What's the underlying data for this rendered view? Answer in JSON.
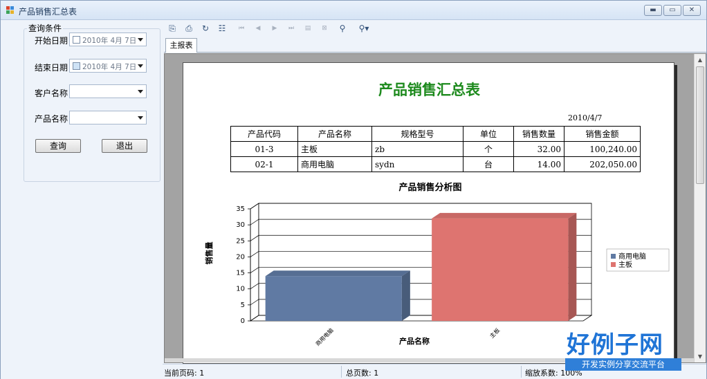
{
  "window": {
    "title": "产品销售汇总表"
  },
  "left_panel": {
    "group_title": "查询条件",
    "start_date": {
      "label": "开始日期",
      "value": "2010年 4月 7日"
    },
    "end_date": {
      "label": "结束日期",
      "value": "2010年 4月 7日"
    },
    "customer": {
      "label": "客户名称",
      "value": ""
    },
    "product": {
      "label": "产品名称",
      "value": ""
    },
    "query_button": "查询",
    "exit_button": "退出"
  },
  "viewer": {
    "tab": "主报表",
    "toolbar_icons": [
      "export-icon",
      "print-icon",
      "refresh-icon",
      "group-tree-icon",
      "first-page-icon",
      "prev-page-icon",
      "next-page-icon",
      "last-page-icon",
      "goto-page-icon",
      "stop-icon",
      "search-icon",
      "zoom-icon"
    ]
  },
  "report": {
    "title": "产品销售汇总表",
    "date": "2010/4/7",
    "columns": [
      "产品代码",
      "产品名称",
      "规格型号",
      "单位",
      "销售数量",
      "销售金额"
    ],
    "rows": [
      [
        "01-3",
        "主板",
        "zb",
        "个",
        "32.00",
        "100,240.00"
      ],
      [
        "02-1",
        "商用电脑",
        "sydn",
        "台",
        "14.00",
        "202,050.00"
      ]
    ]
  },
  "chart_data": {
    "type": "bar",
    "title": "产品销售分析图",
    "xlabel": "产品名称",
    "ylabel": "销售量",
    "categories": [
      "商用电脑",
      "主板"
    ],
    "values": [
      14,
      32
    ],
    "ylim": [
      0,
      35
    ],
    "yticks": [
      0,
      5,
      10,
      15,
      20,
      25,
      30,
      35
    ],
    "colors": [
      "#607aa3",
      "#de7470"
    ],
    "legend": [
      "商用电脑",
      "主板"
    ],
    "legend_position": "right",
    "grid": true
  },
  "status": {
    "current_page": "当前页码: 1",
    "total_pages": "总页数: 1",
    "zoom": "缩放系数: 100%"
  },
  "brand": {
    "name": "好例子网",
    "tagline": "开发实例分享交流平台"
  }
}
